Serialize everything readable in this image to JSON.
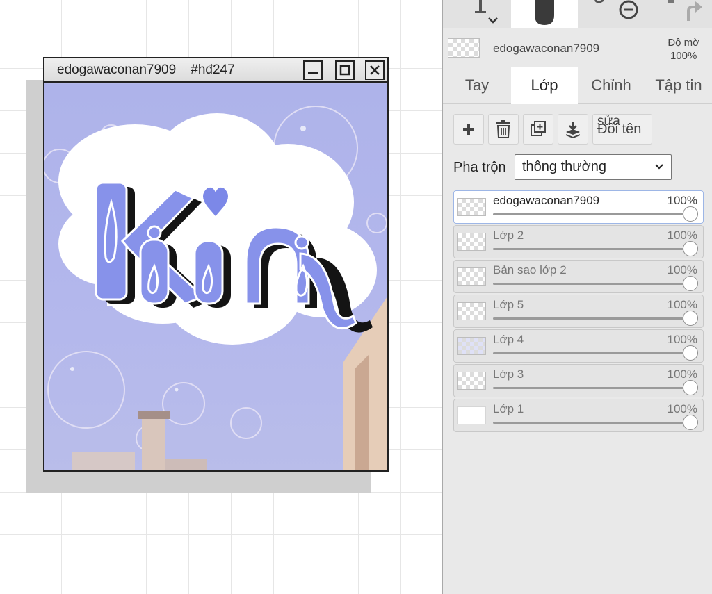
{
  "artwork": {
    "title": "edogawaconan7909    #hđ247",
    "lettering": "Kiin"
  },
  "current_layer": {
    "name": "edogawaconan7909",
    "opacity_label": "Độ mờ",
    "opacity_value": "100%"
  },
  "tabs": [
    {
      "label": "Tay",
      "active": false
    },
    {
      "label": "Lớp",
      "active": true
    },
    {
      "label": "Chỉnh",
      "active": false
    },
    {
      "label": "Tập tin",
      "active": false
    }
  ],
  "layer_tools": {
    "add_icon": "plus-icon",
    "delete_icon": "trash-icon",
    "duplicate_icon": "duplicate-icon",
    "merge_icon": "merge-down-icon",
    "rename_label_top": "sửa",
    "rename_label": "Đổi tên"
  },
  "blend": {
    "label": "Pha trộn",
    "value": "thông thường"
  },
  "layers": [
    {
      "name": "edogawaconan7909",
      "opacity": "100%",
      "opacity_fraction": 1.0,
      "selected": true
    },
    {
      "name": "Lớp 2",
      "opacity": "100%",
      "opacity_fraction": 1.0,
      "selected": false
    },
    {
      "name": "Bản sao lớp 2",
      "opacity": "100%",
      "opacity_fraction": 1.0,
      "selected": false
    },
    {
      "name": "Lớp 5",
      "opacity": "100%",
      "opacity_fraction": 1.0,
      "selected": false
    },
    {
      "name": "Lớp 4",
      "opacity": "100%",
      "opacity_fraction": 1.0,
      "selected": false
    },
    {
      "name": "Lớp 3",
      "opacity": "100%",
      "opacity_fraction": 1.0,
      "selected": false
    },
    {
      "name": "Lớp 1",
      "opacity": "100%",
      "opacity_fraction": 1.0,
      "selected": false
    }
  ],
  "colors": {
    "accent_selected_border": "#9db6e6",
    "art_sky": "#b3b7ec",
    "lettering_fill": "#7f8be6"
  }
}
